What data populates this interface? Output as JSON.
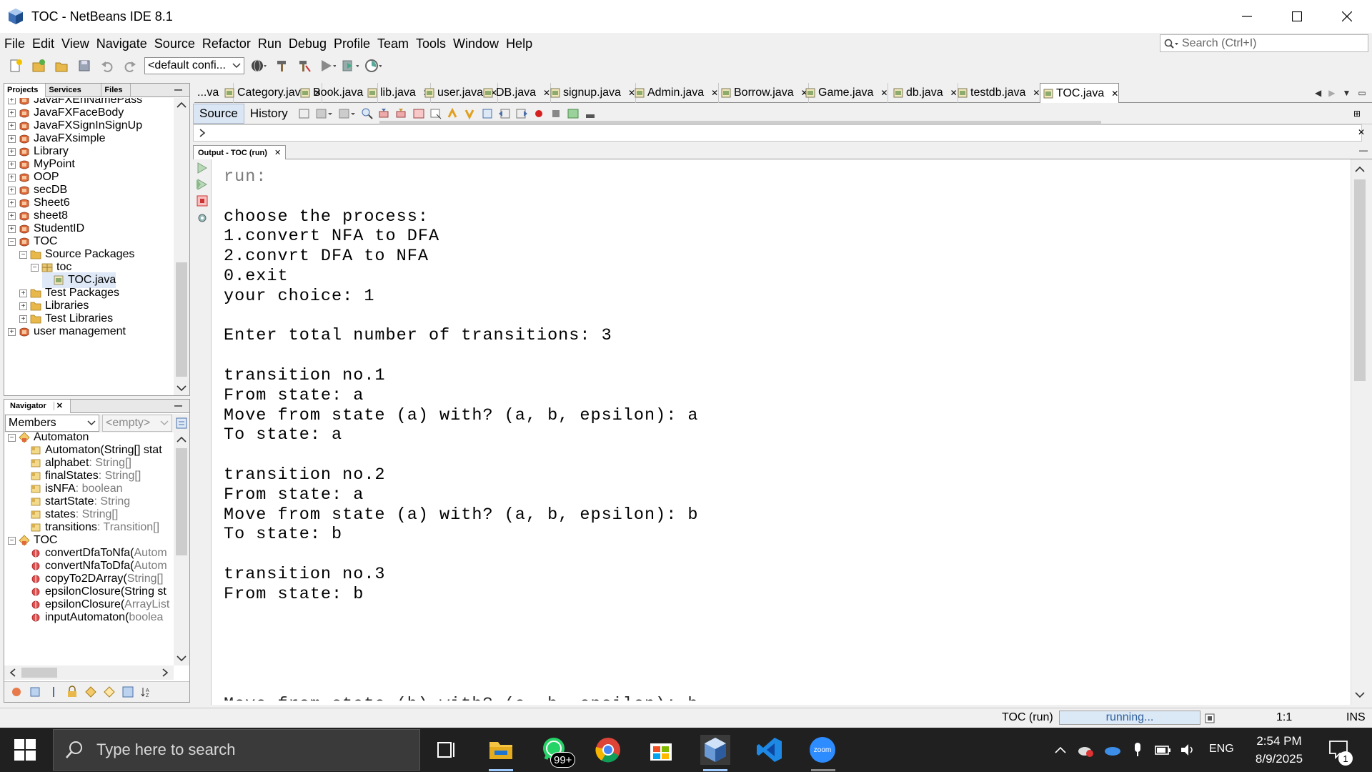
{
  "window": {
    "title": "TOC - NetBeans IDE 8.1"
  },
  "menu": [
    "File",
    "Edit",
    "View",
    "Navigate",
    "Source",
    "Refactor",
    "Run",
    "Debug",
    "Profile",
    "Team",
    "Tools",
    "Window",
    "Help"
  ],
  "search": {
    "placeholder": "Search (Ctrl+I)"
  },
  "toolbar": {
    "config": "<default confi..."
  },
  "projects": {
    "tabs": [
      "Projects",
      "Services",
      "Files"
    ],
    "items": [
      {
        "label": "JavaFXEnNamePass",
        "depth": 0,
        "exp": "+"
      },
      {
        "label": "JavaFXFaceBody",
        "depth": 0,
        "exp": "+"
      },
      {
        "label": "JavaFXSignInSignUp",
        "depth": 0,
        "exp": "+"
      },
      {
        "label": "JavaFXsimple",
        "depth": 0,
        "exp": "+"
      },
      {
        "label": "Library",
        "depth": 0,
        "exp": "+"
      },
      {
        "label": "MyPoint",
        "depth": 0,
        "exp": "+"
      },
      {
        "label": "OOP",
        "depth": 0,
        "exp": "+"
      },
      {
        "label": "secDB",
        "depth": 0,
        "exp": "+"
      },
      {
        "label": "Sheet6",
        "depth": 0,
        "exp": "+"
      },
      {
        "label": "sheet8",
        "depth": 0,
        "exp": "+"
      },
      {
        "label": "StudentID",
        "depth": 0,
        "exp": "+"
      },
      {
        "label": "TOC",
        "depth": 0,
        "exp": "-"
      },
      {
        "label": "Source Packages",
        "depth": 1,
        "exp": "-"
      },
      {
        "label": "toc",
        "depth": 2,
        "exp": "-"
      },
      {
        "label": "TOC.java",
        "depth": 3,
        "exp": ""
      },
      {
        "label": "Test Packages",
        "depth": 1,
        "exp": "+"
      },
      {
        "label": "Libraries",
        "depth": 1,
        "exp": "+"
      },
      {
        "label": "Test Libraries",
        "depth": 1,
        "exp": "+"
      },
      {
        "label": "user management",
        "depth": 0,
        "exp": "+"
      }
    ]
  },
  "navigator": {
    "title": "Navigator",
    "members_select": "Members",
    "empty_select": "<empty>",
    "items": [
      {
        "name": "Automaton",
        "type": "",
        "depth": 0,
        "exp": "-"
      },
      {
        "name": "Automaton(String[] stat",
        "type": "",
        "depth": 1,
        "exp": ""
      },
      {
        "name": "alphabet",
        "type": " : String[]",
        "depth": 1,
        "exp": ""
      },
      {
        "name": "finalStates",
        "type": " : String[]",
        "depth": 1,
        "exp": ""
      },
      {
        "name": "isNFA",
        "type": " : boolean",
        "depth": 1,
        "exp": ""
      },
      {
        "name": "startState",
        "type": " : String",
        "depth": 1,
        "exp": ""
      },
      {
        "name": "states",
        "type": " : String[]",
        "depth": 1,
        "exp": ""
      },
      {
        "name": "transitions",
        "type": " : Transition[]",
        "depth": 1,
        "exp": ""
      },
      {
        "name": "TOC",
        "type": "",
        "depth": 0,
        "exp": "-"
      },
      {
        "name": "convertDfaToNfa(",
        "type": "Autom",
        "depth": 1,
        "exp": ""
      },
      {
        "name": "convertNfaToDfa(",
        "type": "Autom",
        "depth": 1,
        "exp": ""
      },
      {
        "name": "copyTo2DArray(",
        "type": "String[]",
        "depth": 1,
        "exp": ""
      },
      {
        "name": "epsilonClosure(String st",
        "type": "",
        "depth": 1,
        "exp": ""
      },
      {
        "name": "epsilonClosure(",
        "type": "ArrayList",
        "depth": 1,
        "exp": ""
      },
      {
        "name": "inputAutomaton(",
        "type": "boolea",
        "depth": 1,
        "exp": ""
      }
    ]
  },
  "editor": {
    "tabs": [
      {
        "label": "...va",
        "active": false
      },
      {
        "label": "Category.java",
        "active": false
      },
      {
        "label": "Book.java",
        "active": false
      },
      {
        "label": "lib.java",
        "active": false
      },
      {
        "label": "user.java",
        "active": false
      },
      {
        "label": "DB.java",
        "active": false
      },
      {
        "label": "signup.java",
        "active": false
      },
      {
        "label": "Admin.java",
        "active": false
      },
      {
        "label": "Borrow.java",
        "active": false
      },
      {
        "label": "Game.java",
        "active": false
      },
      {
        "label": "db.java",
        "active": false
      },
      {
        "label": "testdb.java",
        "active": false
      },
      {
        "label": "TOC.java",
        "active": true
      }
    ],
    "source_label": "Source",
    "history_label": "History"
  },
  "output": {
    "tab_label": "Output - TOC (run)",
    "lines": [
      "run:",
      "",
      "choose the process:",
      "1.convert NFA to DFA",
      "2.convrt DFA to NFA",
      "0.exit",
      "your choice: 1",
      "",
      "Enter total number of transitions: 3",
      "",
      "transition no.1",
      "From state: a",
      "Move from state (a) with? (a, b, epsilon): a",
      "To state: a",
      "",
      "transition no.2",
      "From state: a",
      "Move from state (a) with? (a, b, epsilon): b",
      "To state: b",
      "",
      "transition no.3",
      "From state: b"
    ]
  },
  "status": {
    "task": "TOC (run)",
    "progress_text": "running...",
    "position": "1:1",
    "mode": "INS"
  },
  "taskbar": {
    "search_placeholder": "Type here to search",
    "whatsapp_badge": "99+",
    "lang": "ENG",
    "time": "2:54 PM",
    "date": "8/9/2025",
    "notif_count": "1",
    "zoom_label": "zoom"
  }
}
